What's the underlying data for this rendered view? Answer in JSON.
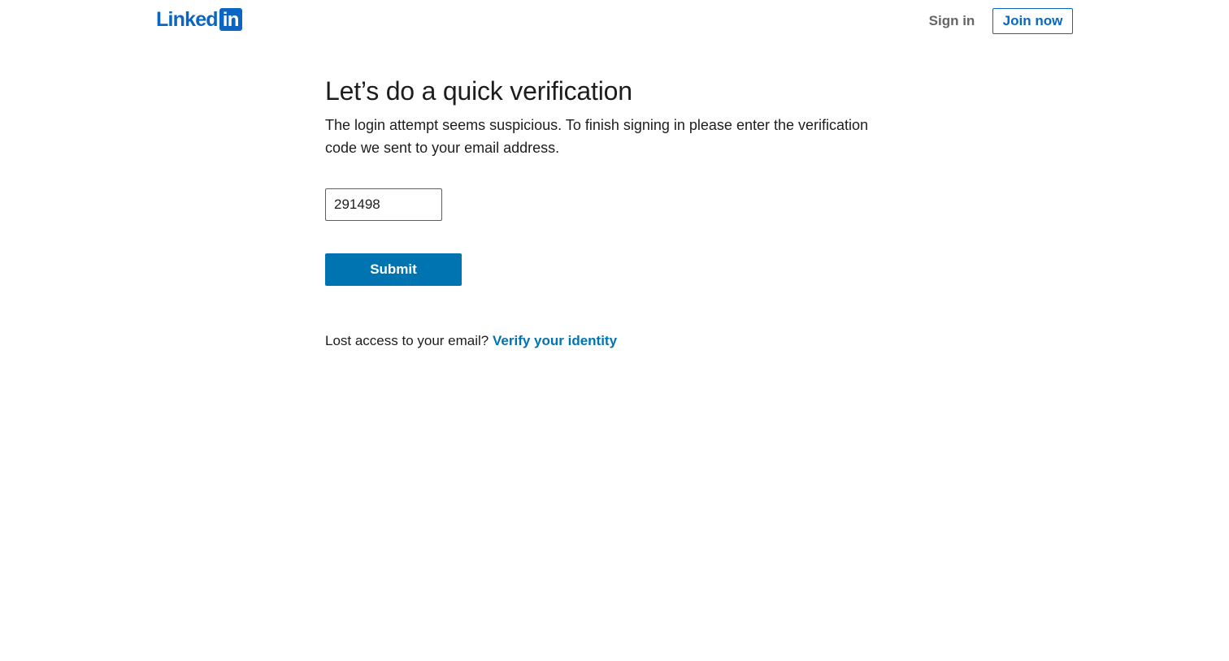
{
  "header": {
    "logo": {
      "text": "Linked",
      "box_text": "in",
      "brand_color": "#0a66c2"
    },
    "sign_in_label": "Sign in",
    "join_now_label": "Join now"
  },
  "main": {
    "title": "Let’s do a quick verification",
    "description": "The login attempt seems suspicious. To finish signing in please enter the verification code we sent to your email address.",
    "code_input": {
      "value": "291498",
      "placeholder": ""
    },
    "submit_label": "Submit",
    "submit_color": "#0073b1",
    "lost_access_text": "Lost access to your email?",
    "verify_link_label": "Verify your identity"
  }
}
